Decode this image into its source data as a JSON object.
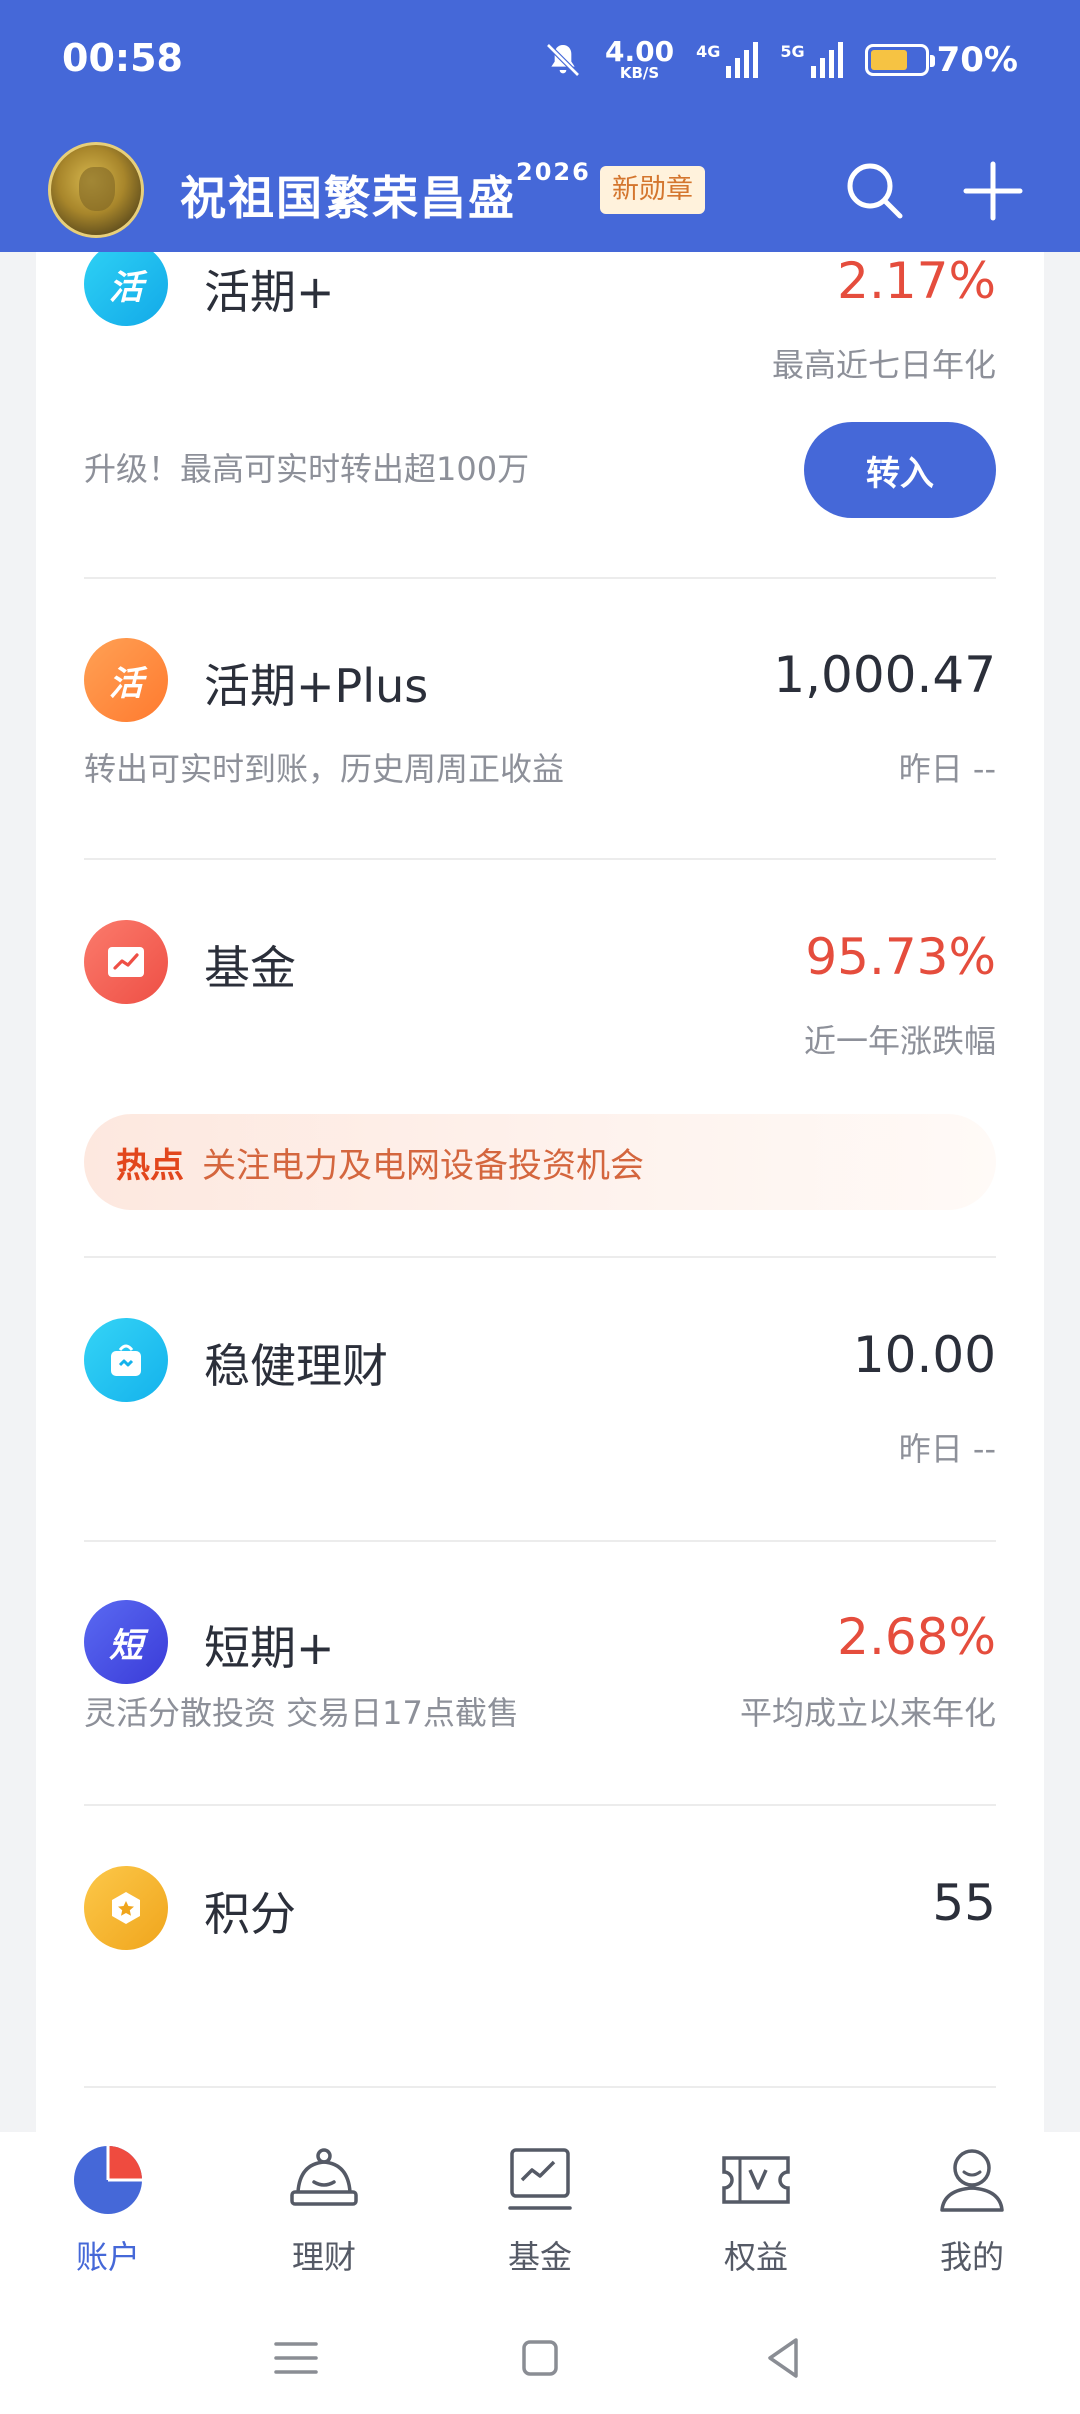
{
  "status": {
    "time": "00:58",
    "net_speed": "4.00",
    "net_unit": "KB/S",
    "sig1_label": "4G",
    "sig2_label": "5G",
    "battery": "70%",
    "battery_level": 0.7
  },
  "header": {
    "title": "祝祖国繁荣昌盛",
    "title_sup": "2026",
    "badge": "新勋章"
  },
  "items": {
    "huoqi": {
      "icon_char": "活",
      "name": "活期+",
      "value": "2.17%",
      "sub_right": "最高近七日年化",
      "promo": "升级！最高可实时转出超100万",
      "button": "转入"
    },
    "huoqi_plus": {
      "icon_char": "活",
      "name": "活期+Plus",
      "value": "1,000.47",
      "sub": "转出可实时到账，历史周周正收益",
      "sub_right": "昨日  --"
    },
    "fund": {
      "name": "基金",
      "value": "95.73%",
      "sub_right": "近一年涨跌幅",
      "hot_tag": "热点",
      "hot_text": "关注电力及电网设备投资机会"
    },
    "wenjian": {
      "name": "稳健理财",
      "value": "10.00",
      "sub_right": "昨日  --"
    },
    "duanqi": {
      "icon_char": "短",
      "name": "短期+",
      "value": "2.68%",
      "sub": "灵活分散投资 交易日17点截售",
      "sub_right": "平均成立以来年化"
    },
    "points": {
      "name": "积分",
      "value": "55"
    }
  },
  "tabs": [
    {
      "label": "账户",
      "icon": "pie-chart-icon",
      "active": true
    },
    {
      "label": "理财",
      "icon": "money-bag-icon"
    },
    {
      "label": "基金",
      "icon": "chart-board-icon"
    },
    {
      "label": "权益",
      "icon": "voucher-icon"
    },
    {
      "label": "我的",
      "icon": "user-icon"
    }
  ],
  "colors": {
    "brand": "#4568d8",
    "red": "#e54d3d",
    "cyan": "#1fc3f0",
    "orange": "#ff8a3c",
    "coral": "#f4665a",
    "indigo": "#4254e6",
    "gold": "#f5b731"
  }
}
